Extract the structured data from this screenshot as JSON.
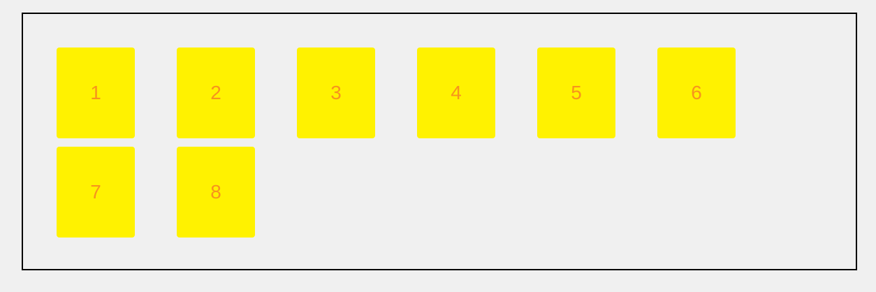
{
  "colors": {
    "page_background": "#f0f0f0",
    "container_border": "#000000",
    "item_background": "#fff200",
    "item_text": "#f7941d"
  },
  "items": [
    "1",
    "2",
    "3",
    "4",
    "5",
    "6",
    "7",
    "8"
  ]
}
